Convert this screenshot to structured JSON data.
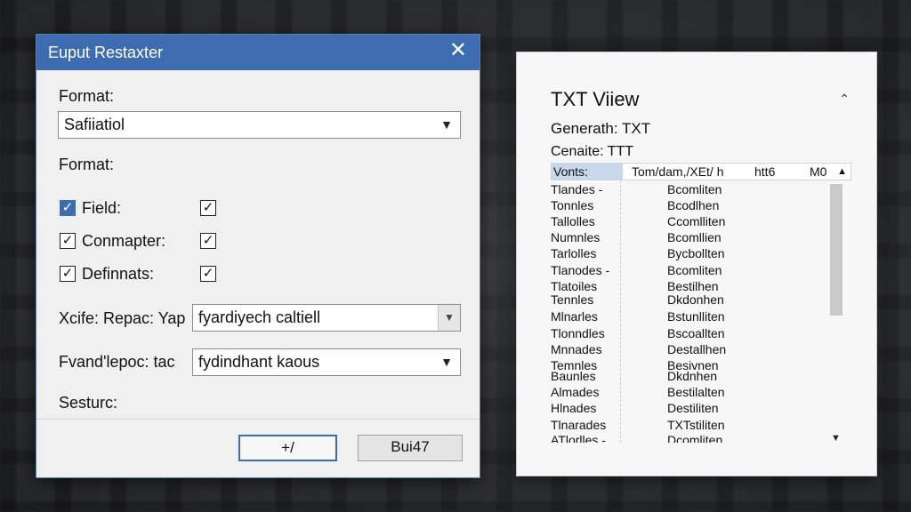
{
  "dialog": {
    "title": "Euput Restaxter",
    "format_label_1": "Format:",
    "format_value": "Safiiatiol",
    "format_label_2": "Format:",
    "options": [
      {
        "label": "Field:",
        "checked": true,
        "checked2": true
      },
      {
        "label": "Conmapter:",
        "checked": true,
        "checked2": true
      },
      {
        "label": "Definnats:",
        "checked": true,
        "checked2": true
      }
    ],
    "row1_label": "Xcife: Repac:  Yap",
    "row1_value": "fyardiyech caltiell",
    "row2_label": "Fvand'lepoc:  tac",
    "row2_value": "fydindhant kaous",
    "status_label": "Sesturc:",
    "ok_label": "+/",
    "build_label": "Bui47"
  },
  "txt_view": {
    "title": "TXT Viiew",
    "generate_line": "Generath: TXT",
    "create_line": "Cenaite: TTT",
    "header": {
      "selected": "Vonts:",
      "path": "Tom/dam,/XEt/ h",
      "col2": "htt6",
      "col3": "M0"
    },
    "rows": [
      [
        "Tlandes -",
        "Bcomliten"
      ],
      [
        "Tonnles",
        "Bcodlhen"
      ],
      [
        "Tallolles",
        "Ccomlliten"
      ],
      [
        "Numnles",
        "Bcomllien"
      ],
      [
        "Tarlolles",
        "Bycbollten"
      ],
      [
        "Tlanodes -",
        "Bcomliten"
      ],
      [
        "Tlatoiles",
        "Bestilhen"
      ],
      [
        "Tennles",
        "Dkdonhen"
      ],
      [
        "Mlnarles",
        "Bstunlliten"
      ],
      [
        "Tlonndles",
        "Bscoallten"
      ],
      [
        "Mnnades",
        "Destallhen"
      ],
      [
        "Temnles",
        "Besivnen"
      ],
      [
        "Baunles",
        "Dkdnhen"
      ],
      [
        "Almades",
        "Bestilalten"
      ],
      [
        "Hlnades",
        "Destiliten"
      ],
      [
        "Tlnarades",
        "TXTstiliten"
      ],
      [
        "ATlorlles -",
        "Dcomliten"
      ]
    ]
  }
}
